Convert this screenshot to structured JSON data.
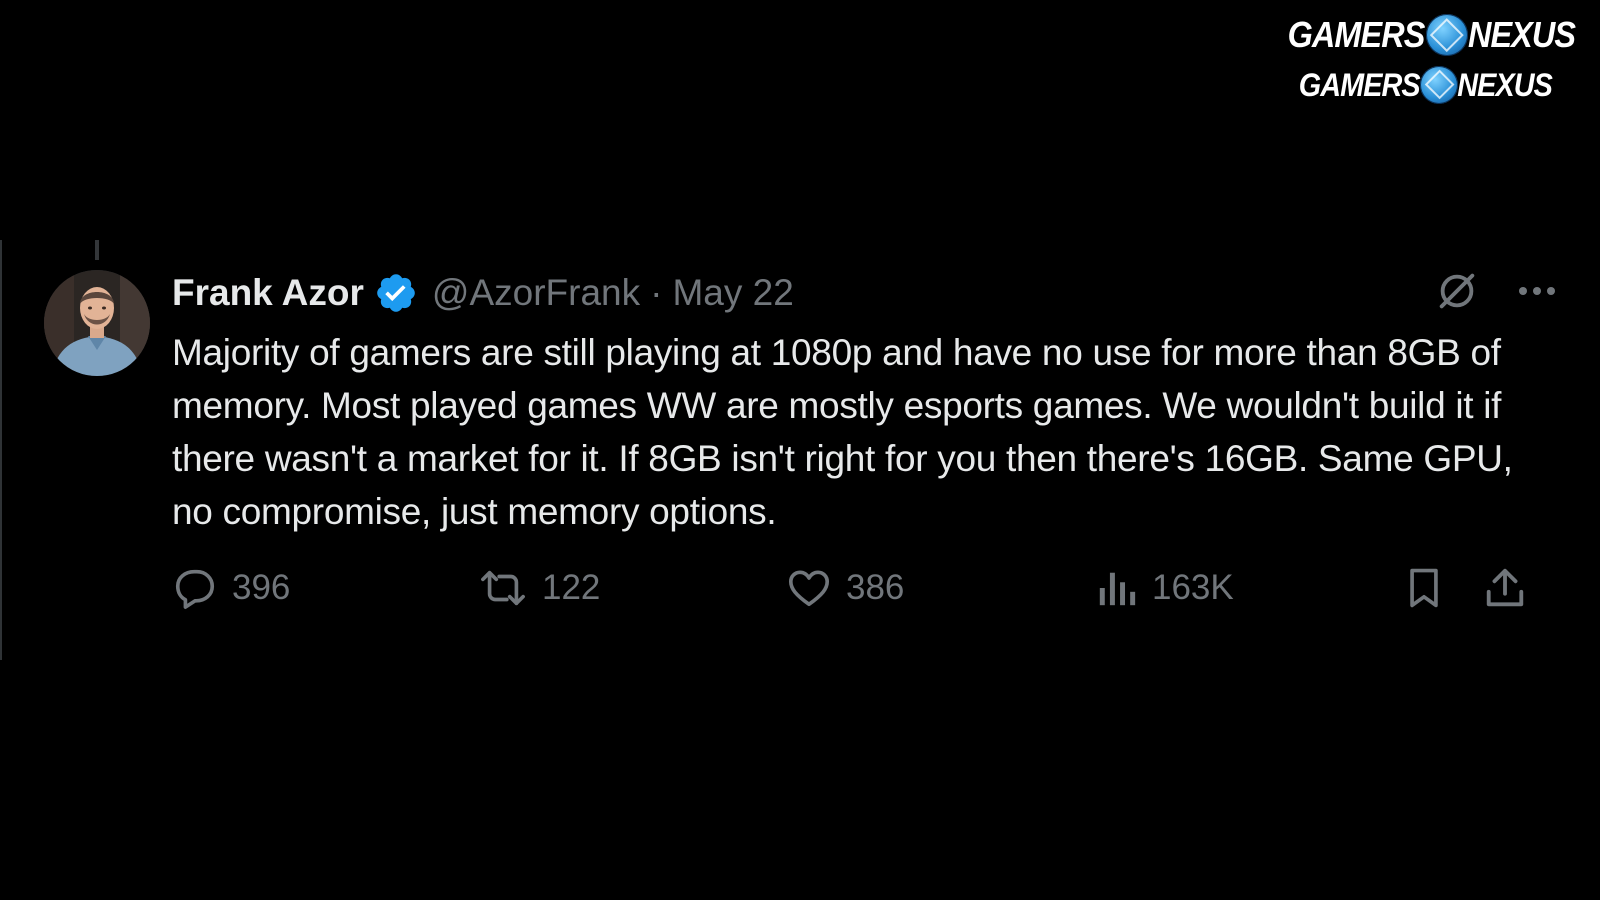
{
  "watermark": {
    "logo_left": "GAMERS",
    "logo_right": "NEXUS"
  },
  "tweet": {
    "author_name": "Frank Azor",
    "handle": "@AzorFrank",
    "separator": "·",
    "date": "May 22",
    "verified": true,
    "text": "Majority of gamers are still playing at 1080p and have no use for more than 8GB of memory. Most played games WW are mostly esports games. We wouldn't build it if there wasn't a market for it. If 8GB isn't right for you then there's 16GB. Same GPU, no compromise, just memory options.",
    "stats": {
      "replies": "396",
      "reposts": "122",
      "likes": "386",
      "views": "163K"
    },
    "icons": {
      "grok": "grok-icon",
      "more": "more-icon",
      "reply": "reply-icon",
      "repost": "repost-icon",
      "like": "heart-icon",
      "views": "views-icon",
      "bookmark": "bookmark-icon",
      "share": "share-icon"
    },
    "colors": {
      "background": "#000000",
      "text": "#e7e9ea",
      "muted": "#71767b",
      "verified": "#1d9bf0"
    }
  }
}
